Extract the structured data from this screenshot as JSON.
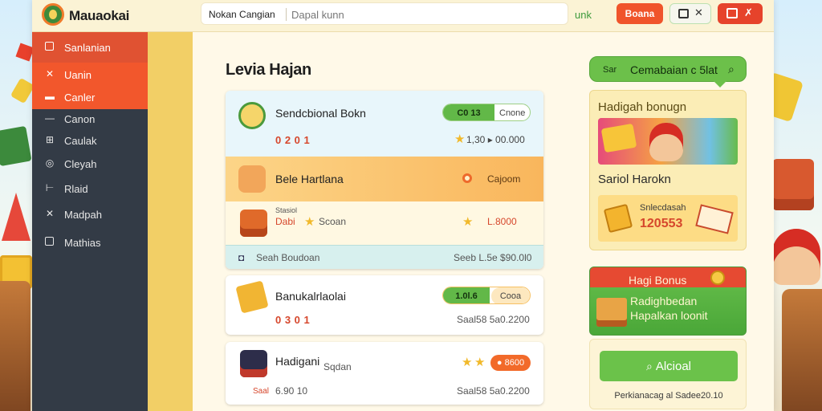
{
  "window": {
    "app_title": "Mauaokai"
  },
  "header": {
    "search_scope": "Nokan Cangian",
    "search_placeholder": "Dapal kunn",
    "link": "unk",
    "primary_button": "Boana",
    "tool_close": "✕",
    "exit_icon_label": "✗"
  },
  "sidebar": {
    "items": [
      {
        "label": "Sanlanian",
        "icon": "square-icon"
      },
      {
        "label": "Uanin",
        "icon": "cross-icon"
      },
      {
        "label": "Canler",
        "icon": "bar-icon"
      },
      {
        "label": "Canon",
        "icon": "minus-icon"
      },
      {
        "label": "Caulak",
        "icon": "grid-icon"
      },
      {
        "label": "Cleyah",
        "icon": "globe-icon"
      },
      {
        "label": "Rlaid",
        "icon": "rule-icon"
      },
      {
        "label": "Madpah",
        "icon": "cross-icon"
      },
      {
        "label": "Mathias",
        "icon": "square-icon"
      }
    ]
  },
  "main": {
    "title": "Levia Hajan",
    "card1": {
      "rowA": {
        "name": "Sendcbional Bokn",
        "number": "0 2 0 1",
        "toggle_on": "C0 13",
        "toggle_off": "Cnone",
        "rating_text": "1,30 ▸ 00.000"
      },
      "rowB": {
        "name": "Bele Hartlana",
        "price": "Cajoom"
      },
      "rowC": {
        "caption": "Stasiol",
        "name": "Dabi",
        "sub": "Scoan",
        "price": "L.8000"
      },
      "rowD": {
        "left": "Seah Boudoan",
        "right": "Seeb L.5e $90.0l0"
      }
    },
    "card2": {
      "name": "Banukalrlaolai",
      "number": "0 3 0 1",
      "toggle_on": "1.0l.6",
      "toggle_off": "Cooa",
      "meta": "Saal58 5a0.2200"
    },
    "card3": {
      "name": "Hadigani",
      "sub": "Sqdan",
      "pill": "● 8600",
      "small": "Saal",
      "number": "6.90 10",
      "meta": "Saal58 5a0.2200"
    }
  },
  "right": {
    "cta": {
      "small": "Sar",
      "big": "Cemabaian c 5lat"
    },
    "promo": {
      "title": "Hadigah bonugn",
      "subtitle": "Sariol Harokn",
      "card_label": "Snlecdasah",
      "card_number": "120553"
    },
    "bonus": {
      "title": "Hagi Bonus",
      "line1": "Radighbedan",
      "line2": "Hapalkan loonit"
    },
    "action": {
      "button": "Alcioal",
      "footer": "Perkianacag al Sadee20.10"
    }
  },
  "colors": {
    "accent_orange": "#f2572c",
    "accent_green": "#6bc24a",
    "sidebar_bg": "#333b46",
    "highlight_yellow": "#f2cf66"
  }
}
